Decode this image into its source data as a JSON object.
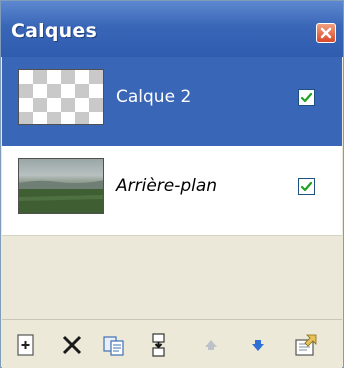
{
  "window": {
    "title": "Calques",
    "close_icon": "close-icon",
    "accent_color": "#3a66b8"
  },
  "layers": [
    {
      "name": "Calque 2",
      "visible": true,
      "selected": true,
      "thumbnail": "transparent-checkerboard"
    },
    {
      "name": "Arrière-plan",
      "visible": true,
      "selected": false,
      "thumbnail": "landscape-photo"
    }
  ],
  "toolbar": {
    "buttons": [
      {
        "name": "add-layer",
        "icon": "new-layer-icon",
        "enabled": true
      },
      {
        "name": "delete-layer",
        "icon": "delete-x-icon",
        "enabled": true
      },
      {
        "name": "duplicate-layer",
        "icon": "duplicate-icon",
        "enabled": true
      },
      {
        "name": "merge-layer-down",
        "icon": "merge-down-icon",
        "enabled": true
      },
      {
        "name": "move-layer-up",
        "icon": "arrow-up-icon",
        "enabled": false
      },
      {
        "name": "move-layer-down",
        "icon": "arrow-down-icon",
        "enabled": true
      },
      {
        "name": "layer-properties",
        "icon": "properties-icon",
        "enabled": true
      }
    ]
  }
}
